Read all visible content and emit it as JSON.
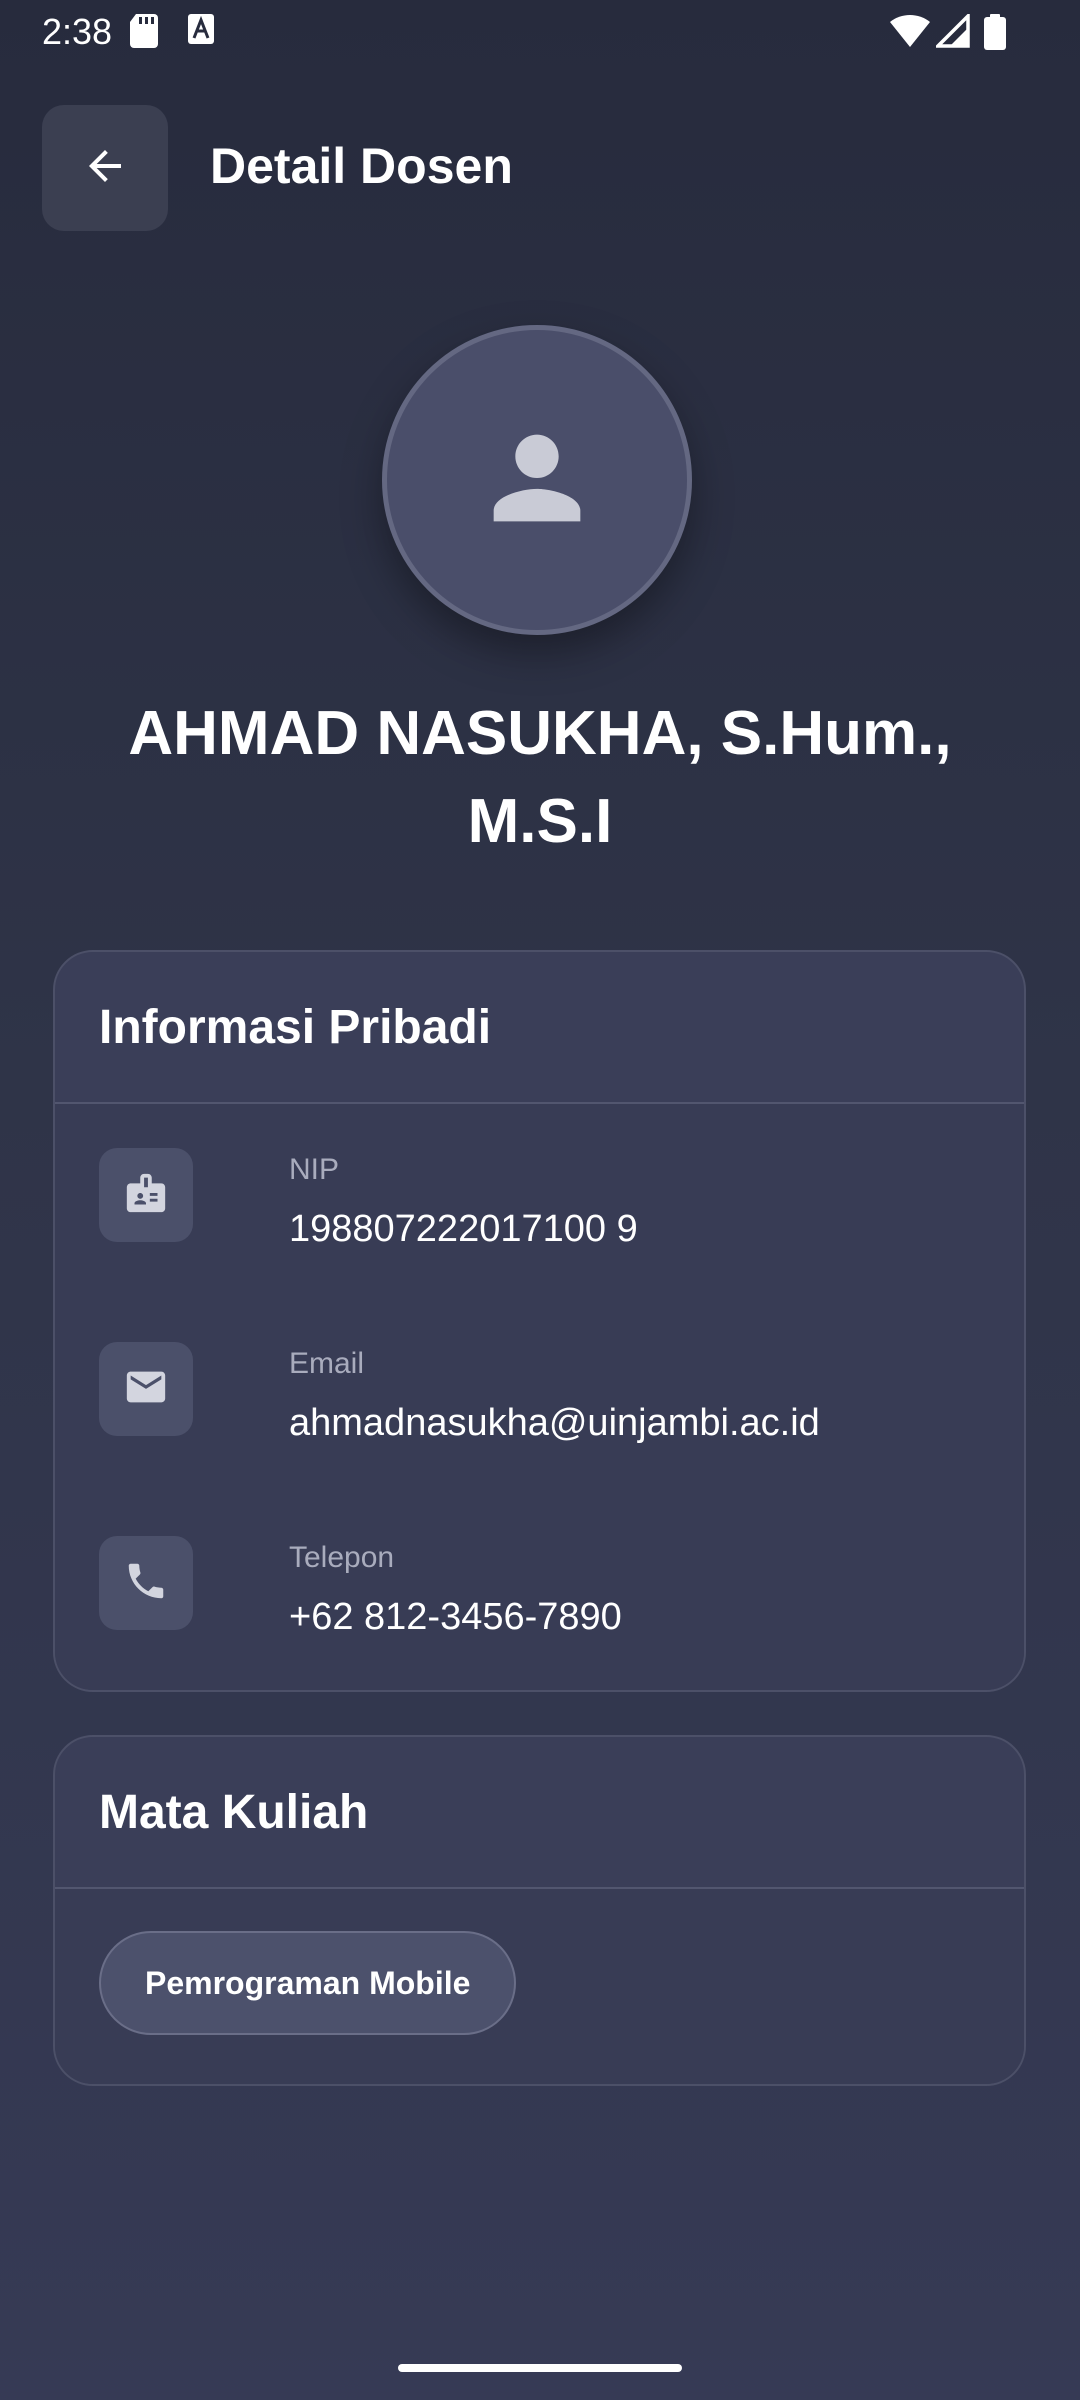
{
  "status_bar": {
    "time": "2:38",
    "icons": [
      "sd-card-icon",
      "a-icon",
      "wifi-icon",
      "signal-icon",
      "battery-icon"
    ]
  },
  "app_bar": {
    "back_icon": "arrow-back-icon",
    "title": "Detail Dosen"
  },
  "profile": {
    "avatar_icon": "person-icon",
    "name": "AHMAD NASUKHA, S.Hum., M.S.I"
  },
  "personal_info": {
    "title": "Informasi Pribadi",
    "items": [
      {
        "icon": "badge-icon",
        "label": "NIP",
        "value": "198807222017100 9"
      },
      {
        "icon": "email-icon",
        "label": "Email",
        "value": "ahmadnasukha@uinjambi.ac.id"
      },
      {
        "icon": "phone-icon",
        "label": "Telepon",
        "value": "+62 812-3456-7890"
      }
    ]
  },
  "courses": {
    "title": "Mata Kuliah",
    "items": [
      "Pemrograman Mobile"
    ]
  },
  "colors": {
    "background": "#2f3448",
    "card": "#3a3e58",
    "icon_box": "#4b506a",
    "text_muted": "#a9acbd"
  }
}
